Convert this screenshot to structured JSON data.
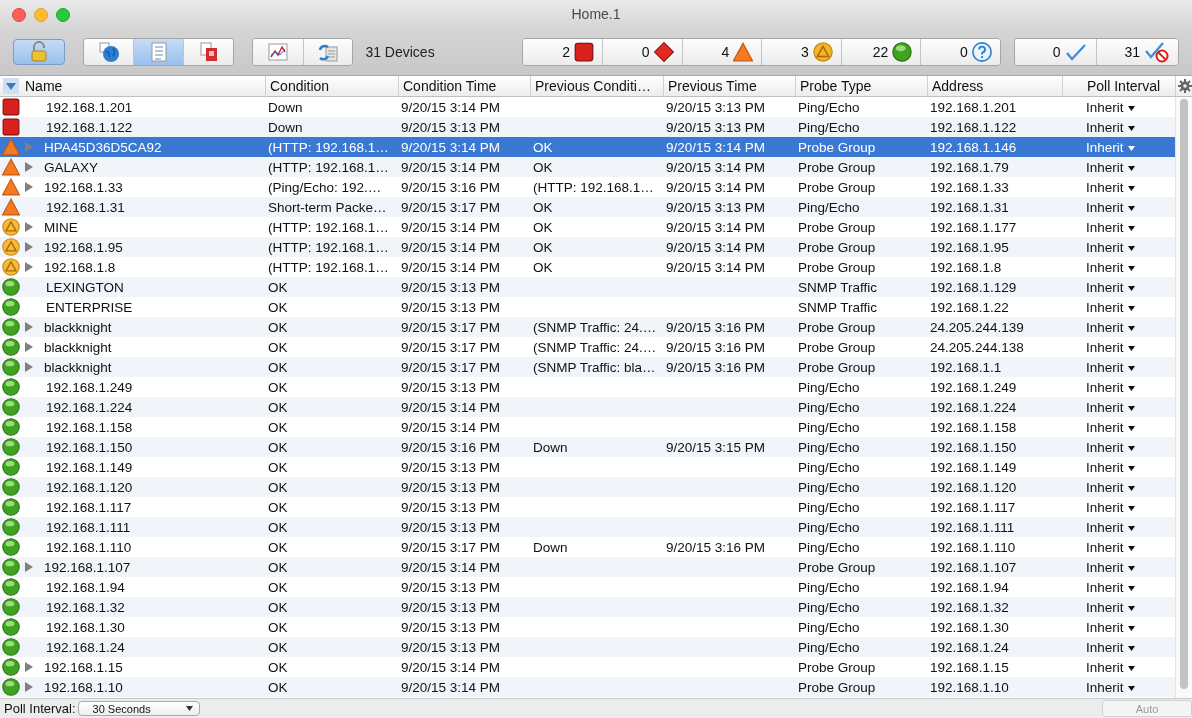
{
  "window": {
    "title": "Home.1"
  },
  "toolbar": {
    "lock_button": {
      "selected": true
    },
    "view_buttons": [
      {
        "kind": "map",
        "selected": false
      },
      {
        "kind": "list",
        "selected": true
      },
      {
        "kind": "report",
        "selected": false
      }
    ],
    "tool_buttons": [
      {
        "kind": "chart"
      },
      {
        "kind": "sync"
      }
    ],
    "device_count": "31 Devices",
    "status_counts": [
      {
        "kind": "down",
        "count": "2"
      },
      {
        "kind": "critical",
        "count": "0"
      },
      {
        "kind": "warning",
        "count": "4"
      },
      {
        "kind": "minor",
        "count": "3"
      },
      {
        "kind": "ok",
        "count": "22"
      },
      {
        "kind": "unknown",
        "count": "0"
      }
    ],
    "ack_counts": [
      {
        "kind": "acknowledged",
        "count": "0"
      },
      {
        "kind": "unacknowledged",
        "count": "31"
      }
    ]
  },
  "table": {
    "columns": [
      "Name",
      "Condition",
      "Condition Time",
      "Previous Conditi…",
      "Previous Time",
      "Probe Type",
      "Address",
      "Poll Interval"
    ],
    "rows": [
      {
        "kind": "down",
        "expandable": false,
        "selected": false,
        "name": "192.168.1.201",
        "condition": "Down",
        "condition_time": "9/20/15 3:14 PM",
        "previous_time": "9/20/15 3:13 PM",
        "probe_type": "Ping/Echo",
        "address": "192.168.1.201",
        "poll_interval": "Inherit"
      },
      {
        "kind": "down",
        "expandable": false,
        "selected": false,
        "name": "192.168.1.122",
        "condition": "Down",
        "condition_time": "9/20/15 3:13 PM",
        "previous_time": "9/20/15 3:13 PM",
        "probe_type": "Ping/Echo",
        "address": "192.168.1.122",
        "poll_interval": "Inherit"
      },
      {
        "kind": "warning",
        "expandable": true,
        "selected": true,
        "name": "HPA45D36D5CA92",
        "condition": "(HTTP: 192.168.1…",
        "condition_time": "9/20/15 3:14 PM",
        "previous_condition": "OK",
        "previous_time": "9/20/15 3:14 PM",
        "probe_type": "Probe Group",
        "address": "192.168.1.146",
        "poll_interval": "Inherit"
      },
      {
        "kind": "warning",
        "expandable": true,
        "selected": false,
        "name": "GALAXY",
        "condition": "(HTTP: 192.168.1…",
        "condition_time": "9/20/15 3:14 PM",
        "previous_condition": "OK",
        "previous_time": "9/20/15 3:14 PM",
        "probe_type": "Probe Group",
        "address": "192.168.1.79",
        "poll_interval": "Inherit"
      },
      {
        "kind": "warning",
        "expandable": true,
        "selected": false,
        "name": "192.168.1.33",
        "condition": "(Ping/Echo: 192.…",
        "condition_time": "9/20/15 3:16 PM",
        "previous_condition": "(HTTP: 192.168.1…",
        "previous_time": "9/20/15 3:14 PM",
        "probe_type": "Probe Group",
        "address": "192.168.1.33",
        "poll_interval": "Inherit"
      },
      {
        "kind": "warning",
        "expandable": false,
        "selected": false,
        "name": "192.168.1.31",
        "condition": "Short-term Packe…",
        "condition_time": "9/20/15 3:17 PM",
        "previous_condition": "OK",
        "previous_time": "9/20/15 3:13 PM",
        "probe_type": "Ping/Echo",
        "address": "192.168.1.31",
        "poll_interval": "Inherit"
      },
      {
        "kind": "minor",
        "expandable": true,
        "selected": false,
        "name": "MINE",
        "condition": "(HTTP: 192.168.1…",
        "condition_time": "9/20/15 3:14 PM",
        "previous_condition": "OK",
        "previous_time": "9/20/15 3:14 PM",
        "probe_type": "Probe Group",
        "address": "192.168.1.177",
        "poll_interval": "Inherit"
      },
      {
        "kind": "minor",
        "expandable": true,
        "selected": false,
        "name": "192.168.1.95",
        "condition": "(HTTP: 192.168.1…",
        "condition_time": "9/20/15 3:14 PM",
        "previous_condition": "OK",
        "previous_time": "9/20/15 3:14 PM",
        "probe_type": "Probe Group",
        "address": "192.168.1.95",
        "poll_interval": "Inherit"
      },
      {
        "kind": "minor",
        "expandable": true,
        "selected": false,
        "name": "192.168.1.8",
        "condition": "(HTTP: 192.168.1…",
        "condition_time": "9/20/15 3:14 PM",
        "previous_condition": "OK",
        "previous_time": "9/20/15 3:14 PM",
        "probe_type": "Probe Group",
        "address": "192.168.1.8",
        "poll_interval": "Inherit"
      },
      {
        "kind": "ok",
        "expandable": false,
        "selected": false,
        "name": "LEXINGTON",
        "condition": "OK",
        "condition_time": "9/20/15 3:13 PM",
        "probe_type": "SNMP Traffic",
        "address": "192.168.1.129",
        "poll_interval": "Inherit"
      },
      {
        "kind": "ok",
        "expandable": false,
        "selected": false,
        "name": "ENTERPRISE",
        "condition": "OK",
        "condition_time": "9/20/15 3:13 PM",
        "probe_type": "SNMP Traffic",
        "address": "192.168.1.22",
        "poll_interval": "Inherit"
      },
      {
        "kind": "ok",
        "expandable": true,
        "selected": false,
        "name": "blackknight",
        "condition": "OK",
        "condition_time": "9/20/15 3:17 PM",
        "previous_condition": "(SNMP Traffic: 24.…",
        "previous_time": "9/20/15 3:16 PM",
        "probe_type": "Probe Group",
        "address": "24.205.244.139",
        "poll_interval": "Inherit"
      },
      {
        "kind": "ok",
        "expandable": true,
        "selected": false,
        "name": "blackknight",
        "condition": "OK",
        "condition_time": "9/20/15 3:17 PM",
        "previous_condition": "(SNMP Traffic: 24.…",
        "previous_time": "9/20/15 3:16 PM",
        "probe_type": "Probe Group",
        "address": "24.205.244.138",
        "poll_interval": "Inherit"
      },
      {
        "kind": "ok",
        "expandable": true,
        "selected": false,
        "name": "blackknight",
        "condition": "OK",
        "condition_time": "9/20/15 3:17 PM",
        "previous_condition": "(SNMP Traffic: bla…",
        "previous_time": "9/20/15 3:16 PM",
        "probe_type": "Probe Group",
        "address": "192.168.1.1",
        "poll_interval": "Inherit"
      },
      {
        "kind": "ok",
        "expandable": false,
        "selected": false,
        "name": "192.168.1.249",
        "condition": "OK",
        "condition_time": "9/20/15 3:13 PM",
        "probe_type": "Ping/Echo",
        "address": "192.168.1.249",
        "poll_interval": "Inherit"
      },
      {
        "kind": "ok",
        "expandable": false,
        "selected": false,
        "name": "192.168.1.224",
        "condition": "OK",
        "condition_time": "9/20/15 3:14 PM",
        "probe_type": "Ping/Echo",
        "address": "192.168.1.224",
        "poll_interval": "Inherit"
      },
      {
        "kind": "ok",
        "expandable": false,
        "selected": false,
        "name": "192.168.1.158",
        "condition": "OK",
        "condition_time": "9/20/15 3:14 PM",
        "probe_type": "Ping/Echo",
        "address": "192.168.1.158",
        "poll_interval": "Inherit"
      },
      {
        "kind": "ok",
        "expandable": false,
        "selected": false,
        "name": "192.168.1.150",
        "condition": "OK",
        "condition_time": "9/20/15 3:16 PM",
        "previous_condition": "Down",
        "previous_time": "9/20/15 3:15 PM",
        "probe_type": "Ping/Echo",
        "address": "192.168.1.150",
        "poll_interval": "Inherit"
      },
      {
        "kind": "ok",
        "expandable": false,
        "selected": false,
        "name": "192.168.1.149",
        "condition": "OK",
        "condition_time": "9/20/15 3:13 PM",
        "probe_type": "Ping/Echo",
        "address": "192.168.1.149",
        "poll_interval": "Inherit"
      },
      {
        "kind": "ok",
        "expandable": false,
        "selected": false,
        "name": "192.168.1.120",
        "condition": "OK",
        "condition_time": "9/20/15 3:13 PM",
        "probe_type": "Ping/Echo",
        "address": "192.168.1.120",
        "poll_interval": "Inherit"
      },
      {
        "kind": "ok",
        "expandable": false,
        "selected": false,
        "name": "192.168.1.117",
        "condition": "OK",
        "condition_time": "9/20/15 3:13 PM",
        "probe_type": "Ping/Echo",
        "address": "192.168.1.117",
        "poll_interval": "Inherit"
      },
      {
        "kind": "ok",
        "expandable": false,
        "selected": false,
        "name": "192.168.1.111",
        "condition": "OK",
        "condition_time": "9/20/15 3:13 PM",
        "probe_type": "Ping/Echo",
        "address": "192.168.1.111",
        "poll_interval": "Inherit"
      },
      {
        "kind": "ok",
        "expandable": false,
        "selected": false,
        "name": "192.168.1.110",
        "condition": "OK",
        "condition_time": "9/20/15 3:17 PM",
        "previous_condition": "Down",
        "previous_time": "9/20/15 3:16 PM",
        "probe_type": "Ping/Echo",
        "address": "192.168.1.110",
        "poll_interval": "Inherit"
      },
      {
        "kind": "ok",
        "expandable": true,
        "selected": false,
        "name": "192.168.1.107",
        "condition": "OK",
        "condition_time": "9/20/15 3:14 PM",
        "probe_type": "Probe Group",
        "address": "192.168.1.107",
        "poll_interval": "Inherit"
      },
      {
        "kind": "ok",
        "expandable": false,
        "selected": false,
        "name": "192.168.1.94",
        "condition": "OK",
        "condition_time": "9/20/15 3:13 PM",
        "probe_type": "Ping/Echo",
        "address": "192.168.1.94",
        "poll_interval": "Inherit"
      },
      {
        "kind": "ok",
        "expandable": false,
        "selected": false,
        "name": "192.168.1.32",
        "condition": "OK",
        "condition_time": "9/20/15 3:13 PM",
        "probe_type": "Ping/Echo",
        "address": "192.168.1.32",
        "poll_interval": "Inherit"
      },
      {
        "kind": "ok",
        "expandable": false,
        "selected": false,
        "name": "192.168.1.30",
        "condition": "OK",
        "condition_time": "9/20/15 3:13 PM",
        "probe_type": "Ping/Echo",
        "address": "192.168.1.30",
        "poll_interval": "Inherit"
      },
      {
        "kind": "ok",
        "expandable": false,
        "selected": false,
        "name": "192.168.1.24",
        "condition": "OK",
        "condition_time": "9/20/15 3:13 PM",
        "probe_type": "Ping/Echo",
        "address": "192.168.1.24",
        "poll_interval": "Inherit"
      },
      {
        "kind": "ok",
        "expandable": true,
        "selected": false,
        "name": "192.168.1.15",
        "condition": "OK",
        "condition_time": "9/20/15 3:14 PM",
        "probe_type": "Probe Group",
        "address": "192.168.1.15",
        "poll_interval": "Inherit"
      },
      {
        "kind": "ok",
        "expandable": true,
        "selected": false,
        "name": "192.168.1.10",
        "condition": "OK",
        "condition_time": "9/20/15 3:14 PM",
        "probe_type": "Probe Group",
        "address": "192.168.1.10",
        "poll_interval": "Inherit"
      }
    ]
  },
  "status_bar": {
    "label": "Poll Interval:",
    "poll_interval": "30 Seconds",
    "auto_button": {
      "label": "Auto",
      "disabled": true
    }
  }
}
